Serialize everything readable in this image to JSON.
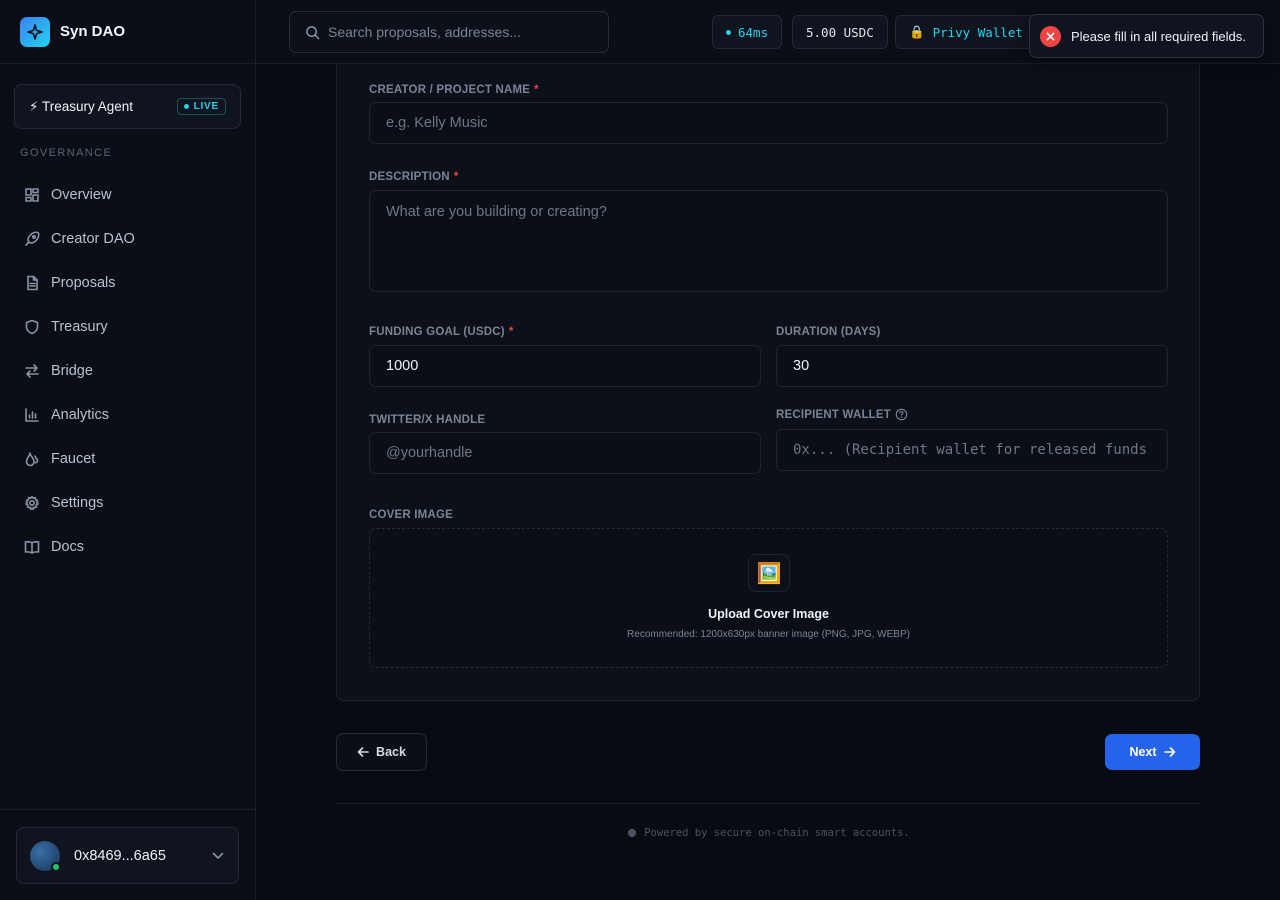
{
  "brand": {
    "name": "Syn DAO",
    "logo_icon": "sparkle-icon"
  },
  "agent": {
    "label": "⚡ Treasury Agent",
    "badge": "LIVE"
  },
  "sidebar": {
    "section": "GOVERNANCE",
    "items": [
      {
        "label": "Overview",
        "icon": "grid-icon"
      },
      {
        "label": "Creator DAO",
        "icon": "rocket-icon"
      },
      {
        "label": "Proposals",
        "icon": "document-icon"
      },
      {
        "label": "Treasury",
        "icon": "shield-icon"
      },
      {
        "label": "Bridge",
        "icon": "arrows-icon"
      },
      {
        "label": "Analytics",
        "icon": "bar-chart-icon"
      },
      {
        "label": "Faucet",
        "icon": "droplet-icon"
      },
      {
        "label": "Settings",
        "icon": "gear-icon"
      },
      {
        "label": "Docs",
        "icon": "book-icon"
      }
    ]
  },
  "user": {
    "address": "0x8469...6a65"
  },
  "topbar": {
    "search_placeholder": "Search proposals, addresses...",
    "latency": "64ms",
    "balance": "5.00 USDC",
    "wallet": "Privy Wallet (",
    "wallet_icon": "lock-icon"
  },
  "toast": {
    "message": "Please fill in all required fields.",
    "color": "#ef4444"
  },
  "form": {
    "creator": {
      "label": "CREATOR / PROJECT NAME",
      "required": "*",
      "placeholder": "e.g. Kelly Music"
    },
    "description": {
      "label": "DESCRIPTION",
      "required": "*",
      "placeholder": "What are you building or creating?"
    },
    "funding": {
      "label": "FUNDING GOAL (USDC)",
      "required": "*",
      "value": "1000"
    },
    "duration": {
      "label": "DURATION (DAYS)",
      "value": "30"
    },
    "twitter": {
      "label": "TWITTER/X HANDLE",
      "placeholder": "@yourhandle"
    },
    "recipient": {
      "label": "RECIPIENT WALLET",
      "placeholder": "0x... (Recipient wallet for released funds"
    },
    "cover": {
      "label": "COVER IMAGE",
      "emoji": "🖼️",
      "title": "Upload Cover Image",
      "subtitle": "Recommended: 1200x630px banner image (PNG, JPG, WEBP)"
    }
  },
  "actions": {
    "back": "Back",
    "next": "Next"
  },
  "footer": {
    "text": "Powered by secure on-chain smart accounts."
  },
  "colors": {
    "accent": "#22d3ee",
    "primary": "#2563eb",
    "error": "#ef4444",
    "background": "#080b12"
  }
}
